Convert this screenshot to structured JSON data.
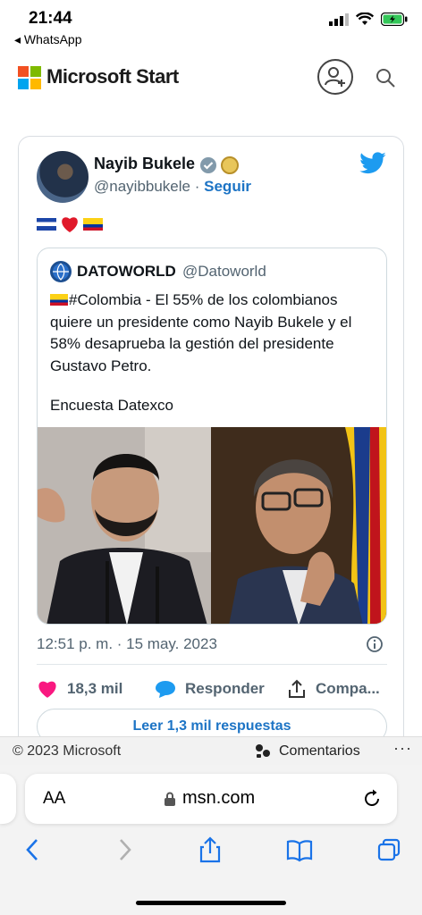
{
  "status_bar": {
    "time": "21:44",
    "back_app": "◂ WhatsApp"
  },
  "header": {
    "title": "Microsoft Start",
    "brand_colors": [
      "#f25022",
      "#7fba00",
      "#00a4ef",
      "#ffb900"
    ]
  },
  "tweet": {
    "author_name": "Nayib Bukele",
    "handle": "@nayibbukele",
    "separator": "·",
    "follow_label": "Seguir",
    "emoji_text": "🇸🇻❤️🇨🇴",
    "quoted": {
      "name": "DATOWORLD",
      "handle": "@Datoworld",
      "text": "#Colombia - El 55% de los colombianos quiere un presidente como Nayib Bukele y el 58% desaprueba la gestión del presidente Gustavo Petro.",
      "source": "Encuesta Datexco"
    },
    "timestamp": "12:51 p. m. · 15 may. 2023",
    "likes": "18,3 mil",
    "reply_label": "Responder",
    "share_label": "Compa...",
    "read_replies_label": "Leer 1,3 mil respuestas",
    "accent_color": "#1d74c5",
    "twitter_color": "#1d9bf0",
    "heart_color": "#f91880"
  },
  "footer": {
    "copyright": "© 2023 Microsoft",
    "comments_label": "Comentarios",
    "more": "···"
  },
  "browser": {
    "aa_label": "AA",
    "url": "msn.com"
  }
}
